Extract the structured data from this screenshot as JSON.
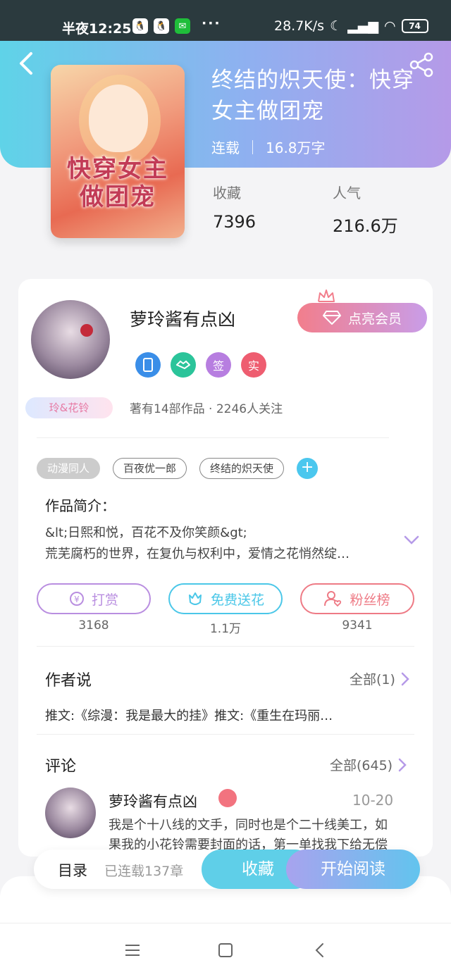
{
  "status_bar": {
    "time": "半夜12:25",
    "net_speed": "28.7K/s",
    "battery": "74",
    "dots": "···"
  },
  "book": {
    "title": "终结的炽天使：快穿女主做团宠",
    "status": "连载",
    "word_count": "16.8万字",
    "cover_text": "快穿女主做团宠",
    "stats": {
      "favorites_label": "收藏",
      "favorites_value": "7396",
      "popularity_label": "人气",
      "popularity_value": "216.6万"
    }
  },
  "author": {
    "name": "萝玲酱有点凶",
    "fan_badge": "玲&花铃",
    "vip_button": "点亮会员",
    "badges": [
      "",
      "",
      "签",
      "实"
    ],
    "stats": "著有14部作品 · 2246人关注"
  },
  "tags": [
    "动漫同人",
    "百夜优一郎",
    "终结的炽天使"
  ],
  "intro": {
    "heading": "作品简介：",
    "line1": "&lt;日熙和悦，百花不及你笑颜&gt;",
    "line2": "荒芜腐朽的世界，在复仇与权利中，爱情之花悄然绽…"
  },
  "actions": [
    {
      "label": "打赏",
      "count": "3168",
      "color": "#b98ee0"
    },
    {
      "label": "免费送花",
      "count": "1.1万",
      "color": "#4bc7e8"
    },
    {
      "label": "粉丝榜",
      "count": "9341",
      "color": "#ee7a85"
    }
  ],
  "author_say": {
    "heading": "作者说",
    "more": "全部(1)",
    "text": "推文:《综漫：我是最大的挂》推文:《重生在玛丽…"
  },
  "comments": {
    "heading": "评论",
    "more": "全部(645)",
    "items": [
      {
        "name": "萝玲酱有点凶",
        "date": "10-20",
        "text": "我是个十八线的文手，同时也是个二十线美工，如果我的小花铃需要封面的话，第一单找我下给无偿"
      }
    ]
  },
  "bottom_bar": {
    "toc_label": "目录",
    "toc_count": "已连载137章",
    "favorite_button": "收藏",
    "read_button": "开始阅读"
  },
  "colors": {
    "header_gradient_start": "#5fd3e8",
    "header_gradient_end": "#b59ae8",
    "accent_blue": "#4bc7ee"
  }
}
